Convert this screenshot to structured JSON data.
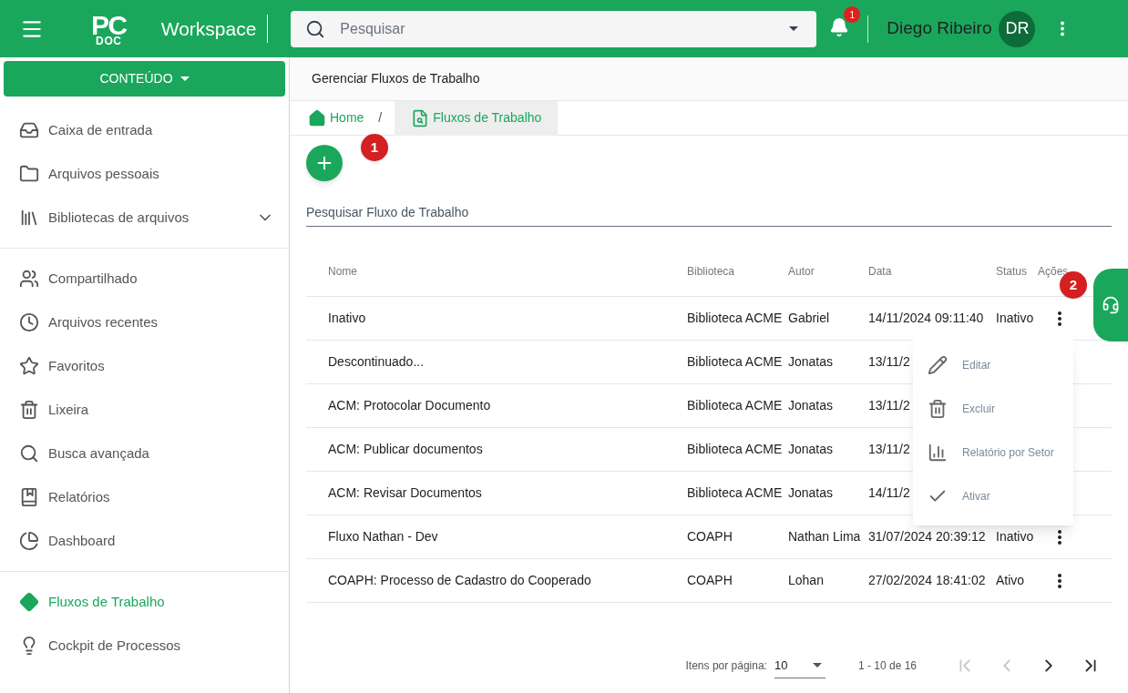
{
  "header": {
    "logo_top": "PC",
    "logo_bottom": "DOC",
    "app_name": "Workspace",
    "search": {
      "placeholder": "Pesquisar"
    },
    "notifications": "1",
    "user_name": "Diego Ribeiro",
    "user_initials": "DR"
  },
  "sidebar": {
    "button": "CONTEÚDO",
    "groups": [
      [
        {
          "label": "Caixa de entrada",
          "selected": false
        },
        {
          "label": "Arquivos pessoais",
          "selected": false
        },
        {
          "label": "Bibliotecas de arquivos",
          "selected": false,
          "expandable": true
        }
      ],
      [
        {
          "label": "Compartilhado",
          "selected": false
        },
        {
          "label": "Arquivos recentes",
          "selected": false
        },
        {
          "label": "Favoritos",
          "selected": false
        },
        {
          "label": "Lixeira",
          "selected": false
        },
        {
          "label": "Busca avançada",
          "selected": false
        },
        {
          "label": "Relatórios",
          "selected": false
        },
        {
          "label": "Dashboard",
          "selected": false
        }
      ],
      [
        {
          "label": "Fluxos de Trabalho",
          "selected": true
        },
        {
          "label": "Cockpit de Processos",
          "selected": false
        }
      ]
    ]
  },
  "page_title": "Gerenciar Fluxos de Trabalho",
  "breadcrumb": [
    {
      "label": "Home",
      "selected": false
    },
    {
      "label": "Fluxos de Trabalho",
      "selected": true
    }
  ],
  "breadcrumb_separator": "/",
  "markers": [
    "1",
    "2"
  ],
  "filter": {
    "placeholder": "Pesquisar Fluxo de Trabalho"
  },
  "table": {
    "columns": [
      "Nome",
      "Biblioteca",
      "Autor",
      "Data",
      "Status",
      "Ações"
    ],
    "rows": [
      {
        "name": "Inativo",
        "library": "Biblioteca ACME",
        "author": "Gabriel",
        "date": "14/11/2024 09:11:40",
        "status": "Inativo"
      },
      {
        "name": "Descontinuado...",
        "library": "Biblioteca ACME",
        "author": "Jonatas",
        "date": "13/11/2"
      },
      {
        "name": "ACM: Protocolar Documento",
        "library": "Biblioteca ACME",
        "author": "Jonatas",
        "date": "13/11/2"
      },
      {
        "name": "ACM: Publicar documentos",
        "library": "Biblioteca ACME",
        "author": "Jonatas",
        "date": "13/11/2"
      },
      {
        "name": "ACM: Revisar Documentos",
        "library": "Biblioteca ACME",
        "author": "Jonatas",
        "date": "14/11/2"
      },
      {
        "name": "Fluxo Nathan - Dev",
        "library": "COAPH",
        "author": "Nathan Lima",
        "date": "31/07/2024 20:39:12",
        "status": "Inativo"
      },
      {
        "name": "COAPH: Processo de Cadastro do Cooperado",
        "library": "COAPH",
        "author": "Lohan",
        "date": "27/02/2024 18:41:02",
        "status": "Ativo"
      }
    ]
  },
  "context_menu": [
    "Editar",
    "Excluir",
    "Relatório por Setor",
    "Ativar"
  ],
  "paginator": {
    "label": "Itens por página:",
    "page_size": "10",
    "range": "1 - 10 de 16",
    "buttons": [
      {
        "disabled": true
      },
      {
        "disabled": true
      },
      {
        "disabled": false
      },
      {
        "disabled": false
      }
    ]
  }
}
